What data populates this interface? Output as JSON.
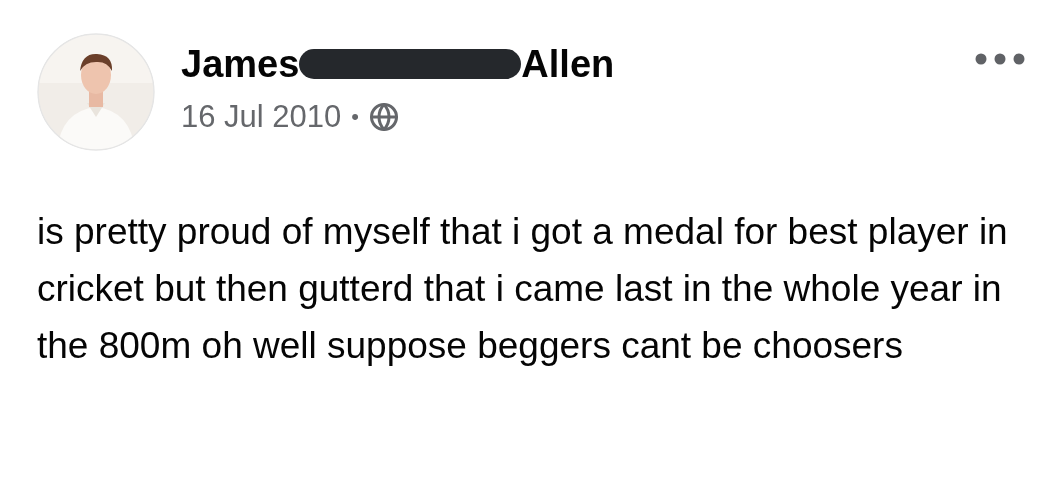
{
  "post": {
    "author_first": "James",
    "author_last": "Allen",
    "redacted": true,
    "date": "16 Jul 2010",
    "separator": "•",
    "text": "is pretty proud of myself that i got a medal for best player in cricket but then gutterd that i came last in the whole year in the 800m oh well suppose beggers cant be choosers"
  }
}
